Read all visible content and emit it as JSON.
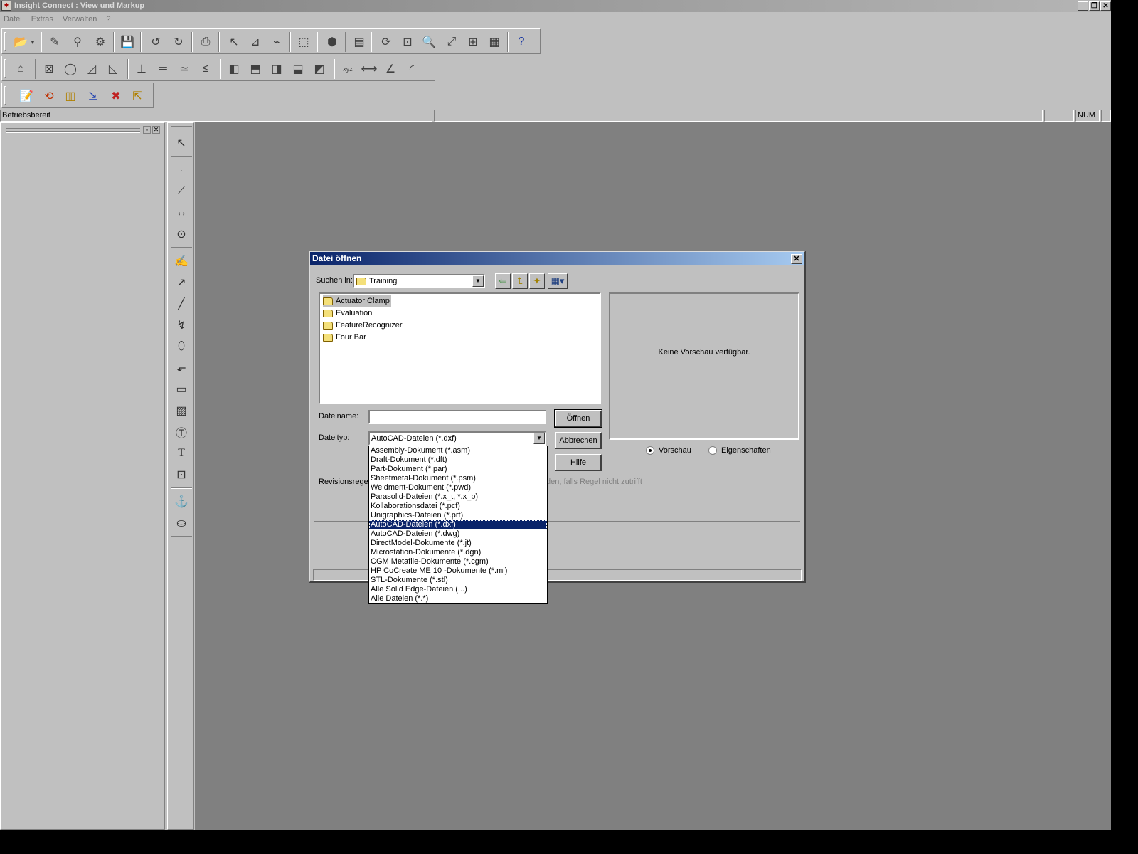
{
  "window": {
    "title": "Insight Connect : View und Markup"
  },
  "menu": [
    "Datei",
    "Extras",
    "Verwalten",
    "?"
  ],
  "status": {
    "text": "Betriebsbereit",
    "num": "NUM"
  },
  "dialog": {
    "title": "Datei öffnen",
    "look_in_label": "Suchen in:",
    "look_in_value": "Training",
    "folders": [
      "Actuator Clamp",
      "Evaluation",
      "FeatureRecognizer",
      "Four Bar"
    ],
    "filename_label": "Dateiname:",
    "filename_value": "",
    "filetype_label": "Dateityp:",
    "filetype_value": "AutoCAD-Dateien (*.dxf)",
    "open_button": "Öffnen",
    "cancel_button": "Abbrechen",
    "help_button": "Hilfe",
    "preview_text": "Keine Vorschau verfügbar.",
    "radio_preview": "Vorschau",
    "radio_properties": "Eigenschaften",
    "revision_label": "Revisionsregel",
    "revision_hint": "den, falls Regel nicht zutrifft",
    "filetype_options": [
      "Assembly-Dokument (*.asm)",
      "Draft-Dokument (*.dft)",
      "Part-Dokument (*.par)",
      "Sheetmetal-Dokument (*.psm)",
      "Weldment-Dokument (*.pwd)",
      "Parasolid-Dateien (*.x_t, *.x_b)",
      "Kollaborationsdatei (*.pcf)",
      "Unigraphics-Dateien (*.prt)",
      "AutoCAD-Dateien (*.dxf)",
      "AutoCAD-Dateien (*.dwg)",
      "DirectModel-Dokumente (*.jt)",
      "Microstation-Dokumente (*.dgn)",
      "CGM Metafile-Dokumente (*.cgm)",
      "HP CoCreate ME 10 -Dokumente (*.mi)",
      "STL-Dokumente (*.stl)",
      "Alle Solid Edge-Dateien (...)",
      "Alle Dateien (*.*)"
    ],
    "selected_option_index": 8
  },
  "colors": {
    "title_active": "#0a246a",
    "title_inactive": "#808080",
    "workspace": "#808080",
    "face": "#c0c0c0"
  }
}
